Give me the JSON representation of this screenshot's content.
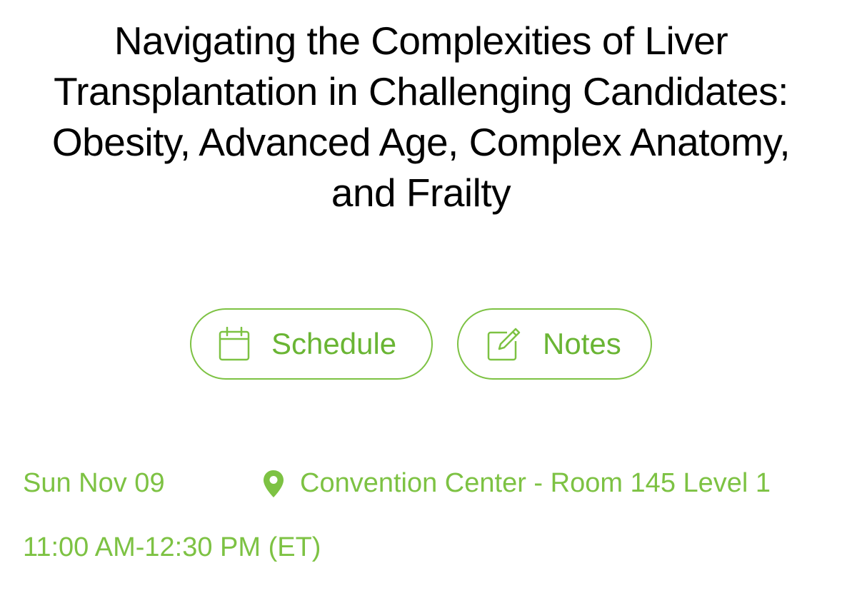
{
  "session": {
    "title": "Navigating the Complexities of Liver Transplantation in Challenging Candidates: Obesity, Advanced Age, Complex Anatomy, and Frailty",
    "date": "Sun Nov 09",
    "location": "Convention Center - Room 145 Level 1",
    "time": "11:00 AM-12:30 PM (ET)"
  },
  "actions": {
    "schedule": {
      "label": "Schedule",
      "icon": "calendar-icon"
    },
    "notes": {
      "label": "Notes",
      "icon": "edit-note-icon"
    }
  },
  "location_icon": "map-pin-icon",
  "colors": {
    "accent": "#7dc243",
    "accent_text": "#6ab534",
    "title_text": "#000000",
    "background": "#ffffff"
  }
}
